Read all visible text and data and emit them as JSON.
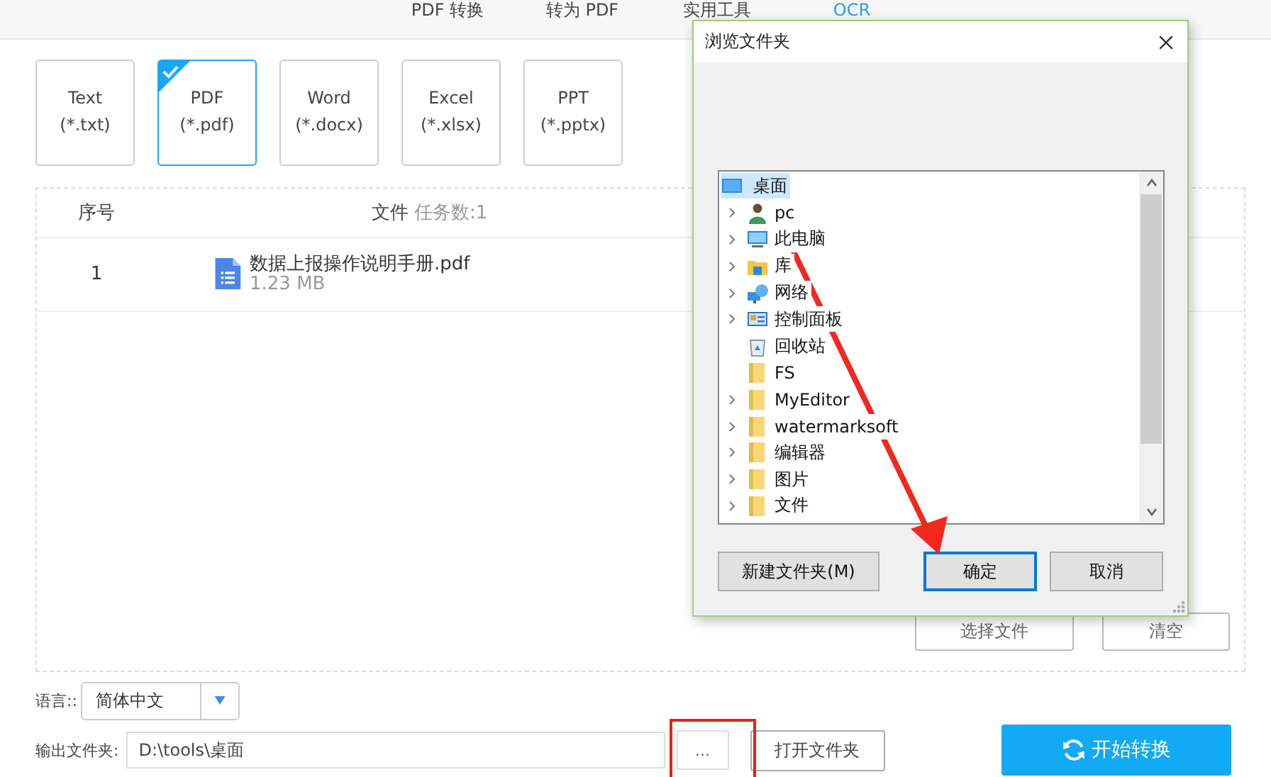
{
  "nav_tabs": [
    {
      "label": "PDF 转换",
      "selected": false
    },
    {
      "label": "转为 PDF",
      "selected": false
    },
    {
      "label": "实用工具",
      "selected": false
    },
    {
      "label": "OCR",
      "selected": true
    }
  ],
  "formats": [
    {
      "label": "Text (*.txt)",
      "selected": false
    },
    {
      "label": "PDF (*.pdf)",
      "selected": true
    },
    {
      "label": "Word (*.docx)",
      "selected": false
    },
    {
      "label": "Excel (*.xlsx)",
      "selected": false
    },
    {
      "label": "PPT (*.pptx)",
      "selected": false
    }
  ],
  "file_table": {
    "columns": [
      "序号",
      "文件"
    ],
    "task_count": "任务数:1",
    "rows": [
      {
        "index": "1",
        "name": "数据上报操作说明手册.pdf",
        "size": "1.23 MB"
      }
    ]
  },
  "file_actions": [
    "选择文件",
    "清空"
  ],
  "language": {
    "label": "语言::",
    "value": "简体中文"
  },
  "output": {
    "label": "输出文件夹:",
    "value": "D:\\tools\\桌面",
    "browse": "...",
    "open": "打开文件夹"
  },
  "start_button": "开始转换",
  "dialog": {
    "title": "浏览文件夹",
    "tree": {
      "label": "桌面",
      "kind": "desktop",
      "selected": true,
      "children": [
        {
          "label": "pc",
          "kind": "user",
          "expandable": true,
          "selected": false
        },
        {
          "label": "此电脑",
          "kind": "computer",
          "expandable": true,
          "selected": false
        },
        {
          "label": "库",
          "kind": "library",
          "expandable": true,
          "selected": false
        },
        {
          "label": "网络",
          "kind": "network",
          "expandable": true,
          "selected": false
        },
        {
          "label": "控制面板",
          "kind": "control-panel",
          "expandable": true,
          "selected": false
        },
        {
          "label": "回收站",
          "kind": "recycle-bin",
          "expandable": false,
          "selected": false
        },
        {
          "label": "FS",
          "kind": "folder",
          "expandable": false,
          "selected": false
        },
        {
          "label": "MyEditor",
          "kind": "folder",
          "expandable": true,
          "selected": false
        },
        {
          "label": "watermarksoft",
          "kind": "folder",
          "expandable": true,
          "selected": false
        },
        {
          "label": "编辑器",
          "kind": "folder",
          "expandable": true,
          "selected": false
        },
        {
          "label": "图片",
          "kind": "folder",
          "expandable": true,
          "selected": false
        },
        {
          "label": "文件",
          "kind": "folder",
          "expandable": true,
          "selected": false
        }
      ]
    },
    "buttons": [
      {
        "label": "新建文件夹(M)",
        "focused": false
      },
      {
        "label": "确定",
        "focused": true
      },
      {
        "label": "取消",
        "focused": false
      }
    ]
  }
}
